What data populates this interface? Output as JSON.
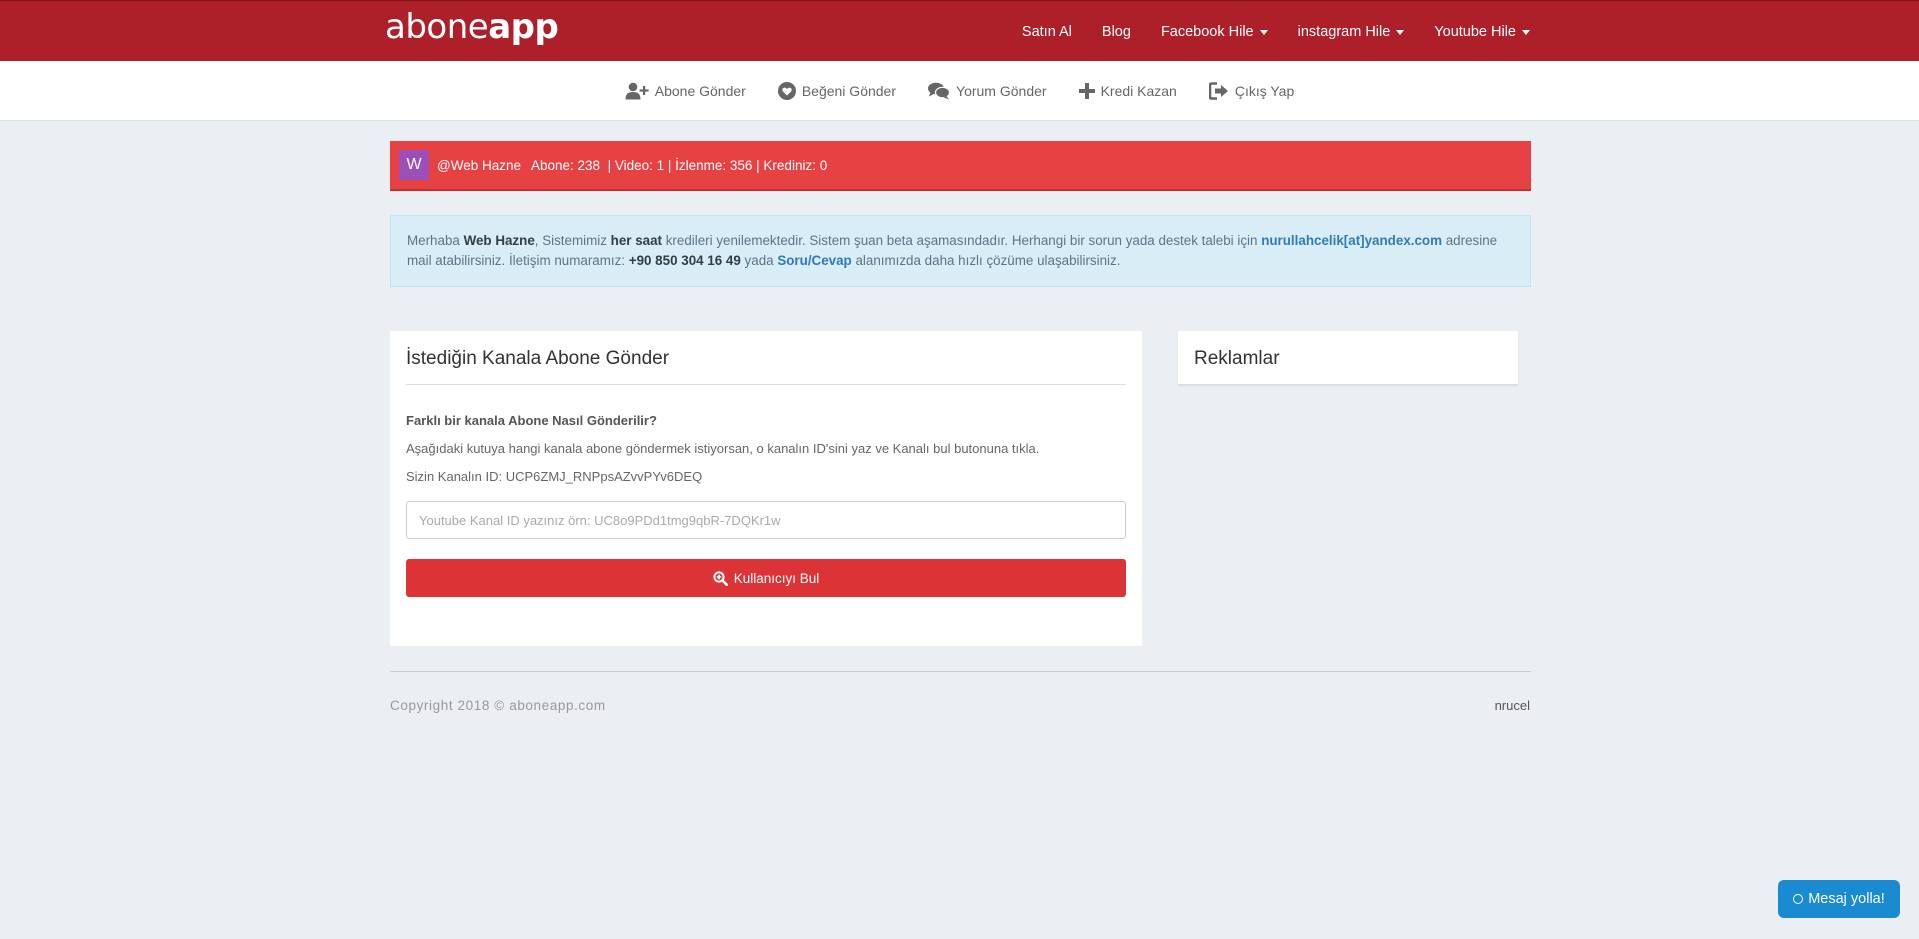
{
  "brand": {
    "light": "abone",
    "bold": "app"
  },
  "topnav": {
    "items": [
      {
        "label": "Satın Al",
        "dropdown": false
      },
      {
        "label": "Blog",
        "dropdown": false
      },
      {
        "label": "Facebook Hile",
        "dropdown": true
      },
      {
        "label": "instagram Hile",
        "dropdown": true
      },
      {
        "label": "Youtube Hile",
        "dropdown": true
      }
    ]
  },
  "subnav": {
    "items": [
      {
        "label": "Abone Gönder",
        "icon": "user-plus-icon"
      },
      {
        "label": "Beğeni Gönder",
        "icon": "heart-icon"
      },
      {
        "label": "Yorum Gönder",
        "icon": "comments-icon"
      },
      {
        "label": "Kredi Kazan",
        "icon": "plus-icon"
      },
      {
        "label": "Çıkış Yap",
        "icon": "sign-out-icon"
      }
    ]
  },
  "userbar": {
    "avatar_letter": "W",
    "username": "@Web Hazne",
    "stats": "Abone: 238  | Video: 1 | İzlenme: 356 | Krediniz: 0"
  },
  "alert": {
    "greeting": "Merhaba ",
    "name": "Web Hazne",
    "t1": ", Sistemimiz ",
    "every_hour": "her saat",
    "t2": " kredileri yenilemektedir. Sistem şuan beta aşamasındadır. Herhangi bir sorun yada destek talebi için ",
    "email": "nurullahcelik[at]yandex.com",
    "t3": " adresine mail atabilirsiniz. İletişim numaramız: ",
    "phone": "+90 850 304 16 49",
    "t4": " yada ",
    "qa_link": "Soru/Cevap",
    "t5": " alanımızda daha hızlı çözüme ulaşabilirsiniz."
  },
  "main": {
    "title": "İstediğin Kanala Abone Gönder",
    "question": "Farklı bir kanala Abone Nasıl Gönderilir?",
    "instruction": "Aşağıdaki kutuya hangi kanala abone göndermek istiyorsan, o kanalın ID'sini yaz ve Kanalı bul butonuna tıkla.",
    "channel_id_text": "Sizin Kanalın ID: UCP6ZMJ_RNPpsAZvvPYv6DEQ",
    "input_placeholder": "Youtube Kanal ID yazınız örn: UC8o9PDd1tmg9qbR-7DQKr1w",
    "input_value": "",
    "button_label": "Kullanıcıyı Bul"
  },
  "ads": {
    "title": "Reklamlar"
  },
  "footer": {
    "copyright": "Copyright 2018 © aboneapp.com",
    "credit": "nrucel"
  },
  "chat": {
    "label": "Mesaj yolla!"
  },
  "colors": {
    "topbar": "#ad2029",
    "userbar": "#e64244",
    "button": "#dc3337",
    "alert_bg": "#d9edf7",
    "chat": "#1a8ad1"
  }
}
